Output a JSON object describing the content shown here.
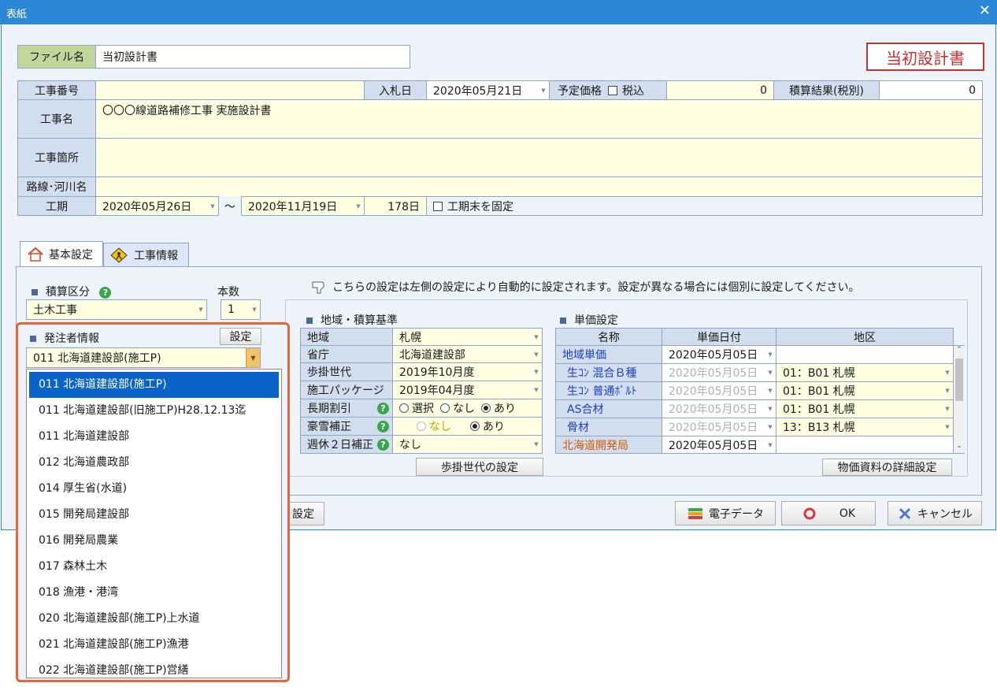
{
  "window": {
    "title": "表紙",
    "close_glyph": "✕"
  },
  "header": {
    "file_label": "ファイル名",
    "file_value": "当初設計書",
    "stamp": "当初設計書",
    "project_no_label": "工事番号",
    "project_no": "",
    "bid_date_label": "入札日",
    "bid_date": "2020年05月21日",
    "planned_price_label": "予定価格",
    "tax_label": "税込",
    "planned_price": "0",
    "estimate_result_label": "積算結果(税別)",
    "estimate_result": "0",
    "project_name_label": "工事名",
    "project_name": "〇〇〇線道路補修工事 実施設計書",
    "location_label": "工事箇所",
    "location": "",
    "route_label": "路線･河川名",
    "route": "",
    "period_label": "工期",
    "period_start": "2020年05月26日",
    "period_sep": "〜",
    "period_end": "2020年11月19日",
    "period_days": "178日",
    "fix_end_label": "工期末を固定"
  },
  "tabs": [
    {
      "label": "基本設定"
    },
    {
      "label": "工事情報"
    }
  ],
  "basic": {
    "estimate_type_label": "積算区分",
    "estimate_type": "土木工事",
    "count_label": "本数",
    "count": "1",
    "client_label": "発注者情報",
    "settings_button": "設定",
    "client_selected": "011 北海道建設部(施工P)",
    "notice": "こちらの設定は左側の設定により自動的に設定されます。設定が異なる場合には個別に設定してください。"
  },
  "region": {
    "title": "地域・積算基準",
    "rows": [
      {
        "label": "地域",
        "value": "札幌"
      },
      {
        "label": "省庁",
        "value": "北海道建設部"
      },
      {
        "label": "歩掛世代",
        "value": "2019年10月度"
      },
      {
        "label": "施工パッケージ",
        "value": "2019年04月度"
      },
      {
        "label": "長期割引",
        "opt1": "選択",
        "opt2": "なし",
        "opt3": "あり"
      },
      {
        "label": "豪雪補正",
        "opt1": "なし",
        "opt2": "あり"
      },
      {
        "label": "週休２日補正",
        "value": "なし"
      }
    ],
    "button": "歩掛世代の設定"
  },
  "price": {
    "title": "単価設定",
    "headers": [
      "名称",
      "単価日付",
      "地区"
    ],
    "rows": [
      {
        "name": "地域単価",
        "date": "2020年05月05日",
        "area": ""
      },
      {
        "name": "生ｺﾝ 混合Ｂ種",
        "date": "2020年05月05日",
        "area": "01：B01 札幌"
      },
      {
        "name": "生ｺﾝ 普通ﾎﾟﾙﾄ",
        "date": "2020年05月05日",
        "area": "01：B01 札幌"
      },
      {
        "name": "AS合材",
        "date": "2020年05月05日",
        "area": "01：B01 札幌"
      },
      {
        "name": "骨材",
        "date": "2020年05月05日",
        "area": "13：B13 札幌"
      },
      {
        "name": "北海道開発局",
        "date": "2020年05月05日",
        "area": ""
      }
    ],
    "button": "物価資料の詳細設定"
  },
  "footer": {
    "partial_button": "設定",
    "edata_button": "電子データ",
    "ok_button": "OK",
    "cancel_button": "キャンセル"
  },
  "dropdown": {
    "items": [
      "011 北海道建設部(施工P)",
      "011 北海道建設部(旧施工P)H28.12.13迄",
      "011 北海道建設部",
      "012 北海道農政部",
      "014 厚生省(水道)",
      "015 開発局建設部",
      "016 開発局農業",
      "017 森林土木",
      "018 漁港・港湾",
      "020 北海道建設部(施工P)上水道",
      "021 北海道建設部(施工P)漁港",
      "022 北海道建設部(施工P)営繕"
    ],
    "selected_index": 0
  },
  "colors": {
    "highlight_border": "#e8643c",
    "selection": "#0a64c8",
    "title_bar": "#2b88d8"
  }
}
